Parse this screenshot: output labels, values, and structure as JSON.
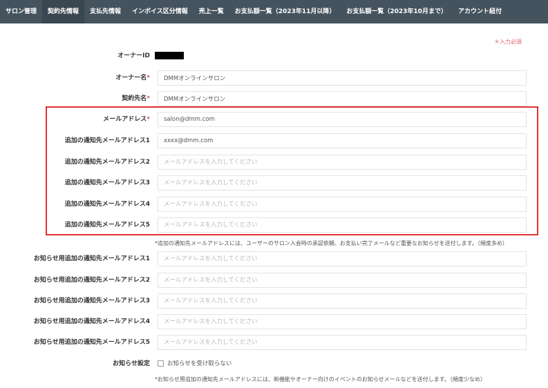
{
  "nav": {
    "tabs": [
      {
        "label": "サロン管理"
      },
      {
        "label": "契約先情報"
      },
      {
        "label": "支払先情報"
      },
      {
        "label": "インボイス区分情報"
      },
      {
        "label": "売上一覧"
      },
      {
        "label": "お支払額一覧（2023年11月以降）"
      },
      {
        "label": "お支払額一覧（2023年10月まで）"
      },
      {
        "label": "アカウント紐付"
      }
    ],
    "active_index": 1
  },
  "form": {
    "required_note": "＊入力必須",
    "owner_id_label": "オーナーID",
    "owner_name_label": "オーナー名",
    "owner_name_value": "DMMオンラインサロン",
    "contract_name_label": "契約先名",
    "contract_name_value": "DMMオンラインサロン",
    "email_label": "メールアドレス",
    "email_value": "salon@dmm.com",
    "required_mark": "*",
    "notify_emails": [
      {
        "label": "追加の通知先メールアドレス1",
        "value": "xxxx@dmm.com",
        "placeholder": "メールアドレスを入力してください"
      },
      {
        "label": "追加の通知先メールアドレス2",
        "value": "",
        "placeholder": "メールアドレスを入力してください"
      },
      {
        "label": "追加の通知先メールアドレス3",
        "value": "",
        "placeholder": "メールアドレスを入力してください"
      },
      {
        "label": "追加の通知先メールアドレス4",
        "value": "",
        "placeholder": "メールアドレスを入力してください"
      },
      {
        "label": "追加の通知先メールアドレス5",
        "value": "",
        "placeholder": "メールアドレスを入力してください"
      }
    ],
    "notify_note": "*追加の通知先メールアドレスには、ユーザーのサロン入会時の承認依頼、お支払い完了メールなど重要なお知らせを送付します。（頻度多め）",
    "news_emails": [
      {
        "label": "お知らせ用追加の通知先メールアドレス1",
        "placeholder": "メールアドレスを入力してください"
      },
      {
        "label": "お知らせ用追加の通知先メールアドレス2",
        "placeholder": "メールアドレスを入力してください"
      },
      {
        "label": "お知らせ用追加の通知先メールアドレス3",
        "placeholder": "メールアドレスを入力してください"
      },
      {
        "label": "お知らせ用追加の通知先メールアドレス4",
        "placeholder": "メールアドレスを入力してください"
      },
      {
        "label": "お知らせ用追加の通知先メールアドレス5",
        "placeholder": "メールアドレスを入力してください"
      }
    ],
    "news_setting_label": "お知らせ設定",
    "news_setting_checkbox_label": "お知らせを受け取らない",
    "news_note": "*お知らせ用追加の通知先メールアドレスには、新機能やオーナー向けのイベントのお知らせメールなどを送付します。（頻度少なめ）"
  },
  "colors": {
    "nav_bg": "#45535e",
    "required": "#d9534f",
    "highlight_border": "#e03030"
  }
}
